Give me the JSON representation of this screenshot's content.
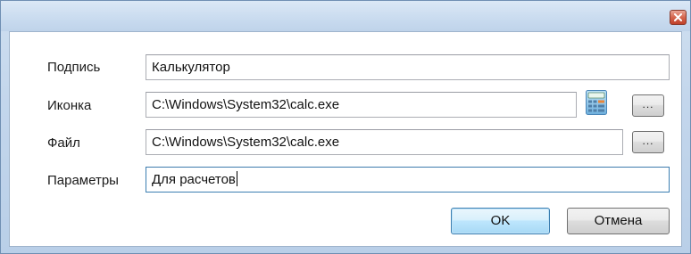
{
  "window": {
    "close_label": "x"
  },
  "form": {
    "caption_label": "Подпись",
    "caption_value": "Калькулятор",
    "icon_label": "Иконка",
    "icon_value": "C:\\Windows\\System32\\calc.exe",
    "icon_browse_label": "...",
    "file_label": "Файл",
    "file_value": "C:\\Windows\\System32\\calc.exe",
    "file_browse_label": "...",
    "params_label": "Параметры",
    "params_value": "Для расчетов"
  },
  "buttons": {
    "ok_label": "OK",
    "cancel_label": "Отмена"
  },
  "icons": {
    "close": "close-icon",
    "preview": "calculator-icon"
  },
  "colors": {
    "accent": "#3c7fb1",
    "title_bar": "#c9dbef",
    "close_button": "#d5664e"
  }
}
